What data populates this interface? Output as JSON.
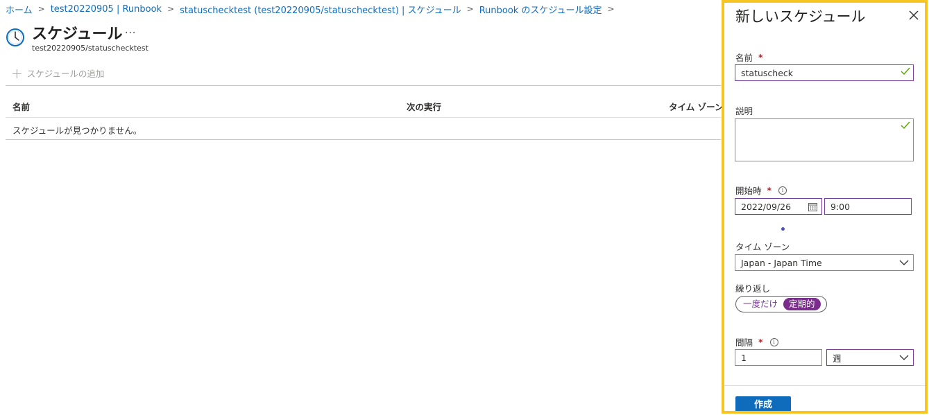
{
  "breadcrumb": [
    "ホーム",
    "test20220905 | Runbook",
    "statuschecktest (test20220905/statuschecktest) | スケジュール",
    "Runbook のスケジュール設定"
  ],
  "page": {
    "title": "スケジュール",
    "more": "...",
    "subtitle": "test20220905/statuschecktest",
    "add_schedule": "スケジュールの追加"
  },
  "grid": {
    "columns": [
      "名前",
      "次の実行",
      "タイム ゾーン"
    ],
    "empty_message": "スケジュールが見つかりません。"
  },
  "panel": {
    "title": "新しいスケジュール",
    "name_label": "名前",
    "name_value": "statuscheck",
    "description_label": "説明",
    "description_value": "",
    "start_label": "開始時",
    "start_date": "2022/09/26",
    "start_time": "9:00",
    "timezone_label": "タイム ゾーン",
    "timezone_value": "Japan - Japan Time",
    "recurrence_label": "繰り返し",
    "recurrence_options": [
      "一度だけ",
      "定期的"
    ],
    "recurrence_selected": "定期的",
    "interval_label": "間隔",
    "interval_value": "1",
    "interval_unit": "週",
    "required_mark": "*",
    "info_glyph": "i",
    "create_button": "作成"
  },
  "colors": {
    "link": "#0f6cbd",
    "panel_highlight": "#f6c423",
    "valid_border": "#7b3f98",
    "toggle_on": "#7b2d8e",
    "required": "#a4262c",
    "check": "#57a300",
    "primary_button": "#0f6cbd"
  },
  "icons": {
    "page": "clock-icon",
    "close": "close-icon",
    "valid": "checkmark-icon",
    "dropdown": "chevron-down-icon",
    "date": "calendar-icon",
    "info": "info-icon",
    "add": "plus-icon"
  }
}
